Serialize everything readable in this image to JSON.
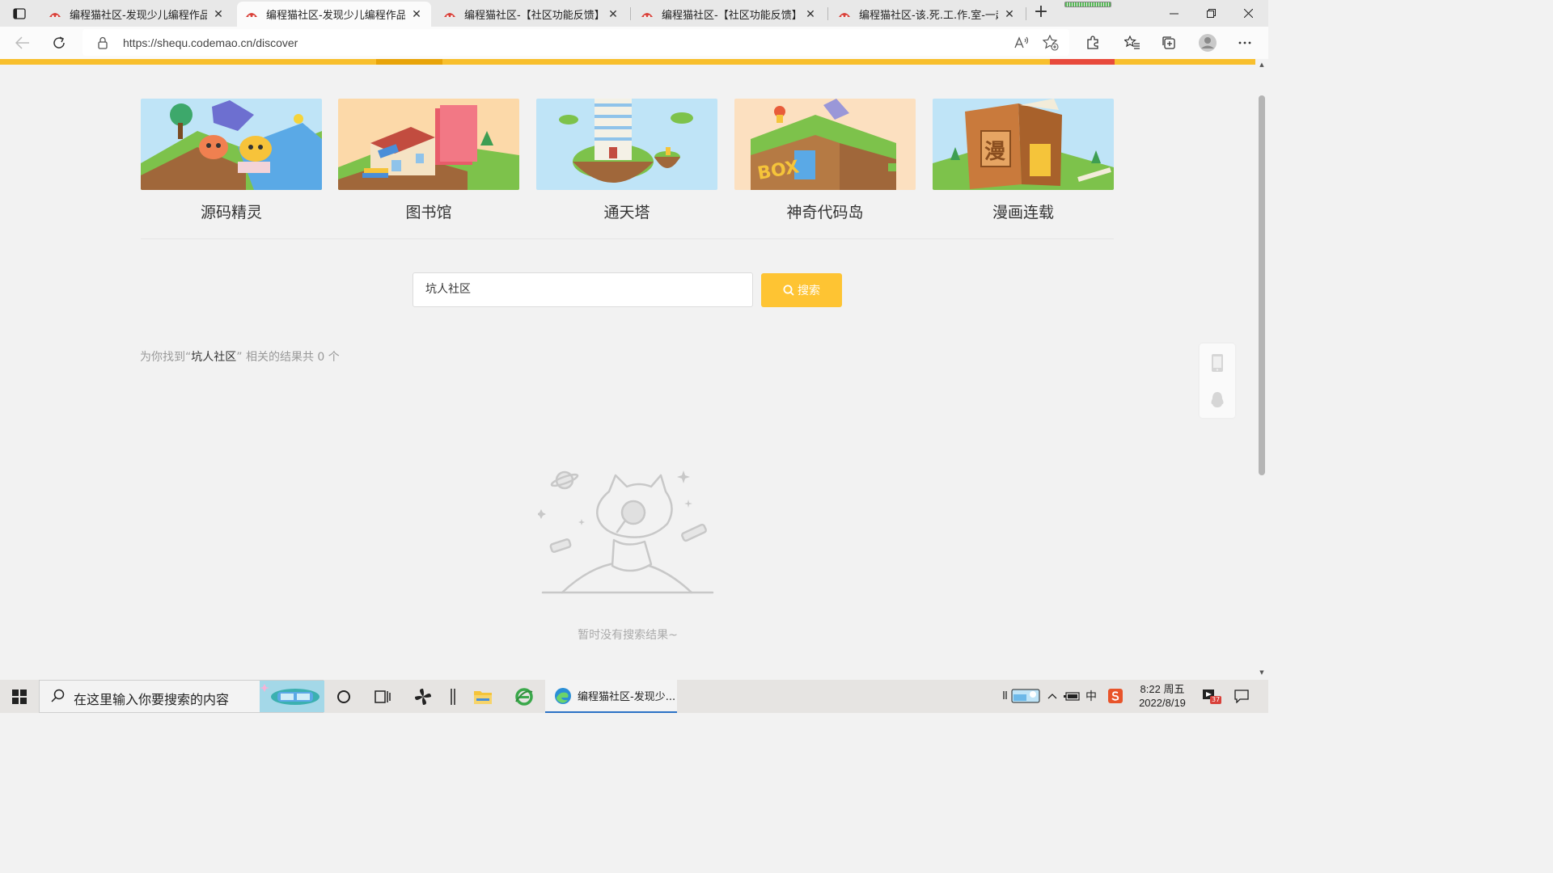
{
  "browser": {
    "tabs": [
      {
        "title": "编程猫社区-发现少儿编程作品",
        "active": false
      },
      {
        "title": "编程猫社区-发现少儿编程作品",
        "active": true
      },
      {
        "title": "编程猫社区-【社区功能反馈】用",
        "active": false
      },
      {
        "title": "编程猫社区-【社区功能反馈】用",
        "active": false
      },
      {
        "title": "编程猫社区-该.死.工.作.室-一起写",
        "active": false
      }
    ],
    "url": "https://shequ.codemao.cn/discover"
  },
  "page": {
    "cards": [
      {
        "label": "源码精灵"
      },
      {
        "label": "图书馆"
      },
      {
        "label": "通天塔"
      },
      {
        "label": "神奇代码岛"
      },
      {
        "label": "漫画连载"
      }
    ],
    "search": {
      "value": "坑人社区",
      "button_label": "搜索"
    },
    "result": {
      "prefix": "为你找到",
      "quote_open": "“",
      "keyword": "坑人社区",
      "quote_close": "”",
      "suffix": "相关的结果共 0 个"
    },
    "empty_text": "暂时没有搜索结果~"
  },
  "taskbar": {
    "search_placeholder": "在这里输入你要搜索的内容",
    "active_app_title": "编程猫社区-发现少...",
    "time": "8:22 周五",
    "date": "2022/8/19",
    "notification_badge": "37"
  },
  "colors": {
    "accent_yellow": "#fec433",
    "header_yellow": "#f8bf2d"
  }
}
